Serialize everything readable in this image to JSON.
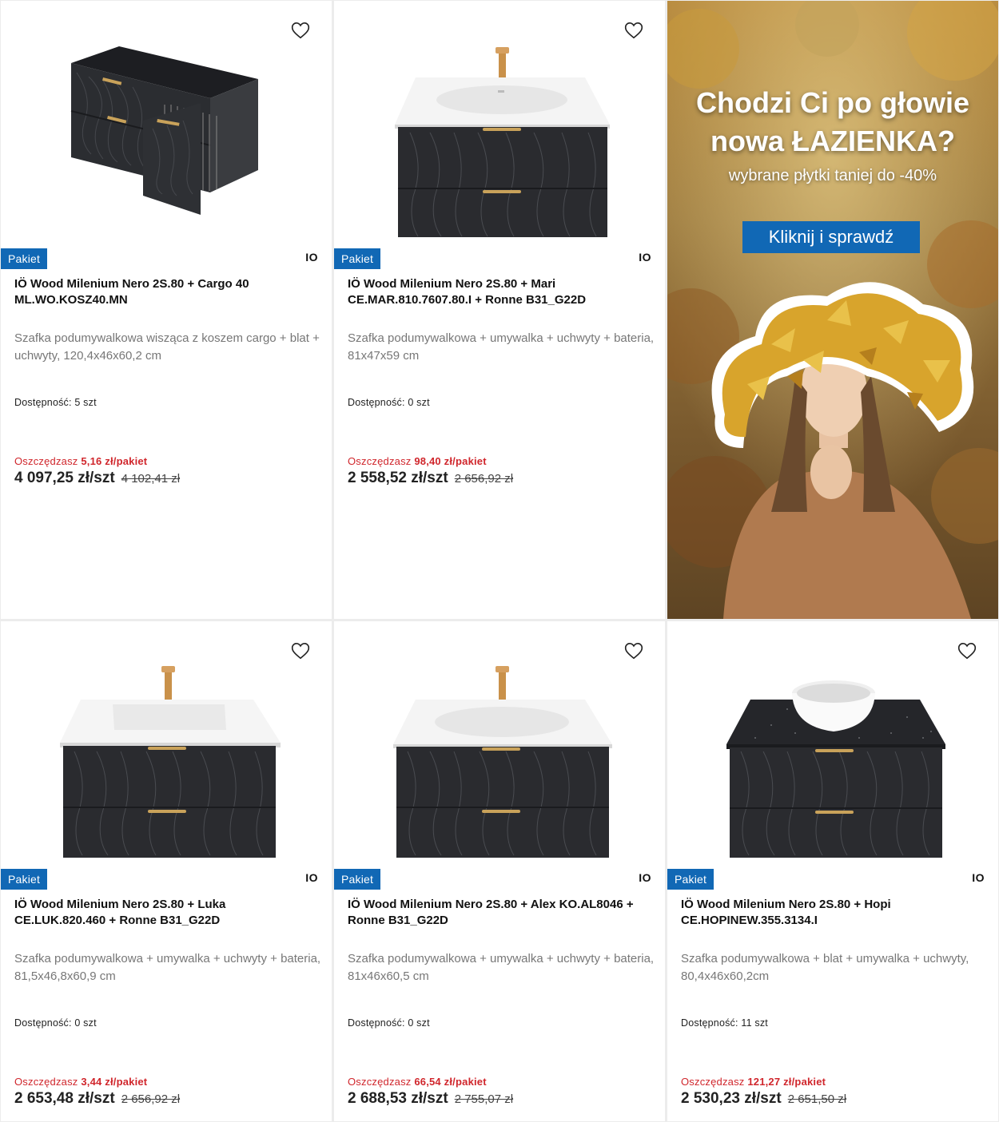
{
  "colors": {
    "accent": "#1168b5",
    "savings": "#d0262c",
    "card_bg": "#ffffff"
  },
  "products": [
    {
      "badge": "Pakiet",
      "brand": "IO",
      "title": "IÖ Wood Milenium Nero 2S.80 + Cargo 40 ML.WO.KOSZ40.MN",
      "description": "Szafka podumywalkowa wisząca z koszem cargo + blat + uchwyty, 120,4x46x60,2 cm",
      "availability": "Dostępność: 5 szt",
      "savings_label": "Oszczędzasz",
      "savings_value": "5,16 zł/pakiet",
      "price": "4 097,25 zł/szt",
      "old_price": "4 102,41 zł",
      "wishlist_icon": "heart-outline-icon"
    },
    {
      "badge": "Pakiet",
      "brand": "IO",
      "title": "IÖ Wood Milenium Nero 2S.80 + Mari CE.MAR.810.7607.80.I + Ronne B31_G22D",
      "description": "Szafka podumywalkowa + umywalka + uchwyty + bateria, 81x47x59 cm",
      "availability": "Dostępność: 0 szt",
      "savings_label": "Oszczędzasz",
      "savings_value": "98,40 zł/pakiet",
      "price": "2 558,52 zł/szt",
      "old_price": "2 656,92 zł",
      "wishlist_icon": "heart-outline-icon"
    },
    {
      "badge": "Pakiet",
      "brand": "IO",
      "title": "IÖ Wood Milenium Nero 2S.80 + Luka CE.LUK.820.460 + Ronne B31_G22D",
      "description": "Szafka podumywalkowa + umywalka + uchwyty + bateria, 81,5x46,8x60,9 cm",
      "availability": "Dostępność: 0 szt",
      "savings_label": "Oszczędzasz",
      "savings_value": "3,44 zł/pakiet",
      "price": "2 653,48 zł/szt",
      "old_price": "2 656,92 zł",
      "wishlist_icon": "heart-outline-icon"
    },
    {
      "badge": "Pakiet",
      "brand": "IO",
      "title": "IÖ Wood Milenium Nero 2S.80 + Alex KO.AL8046 + Ronne B31_G22D",
      "description": "Szafka podumywalkowa + umywalka + uchwyty + bateria, 81x46x60,5 cm",
      "availability": "Dostępność: 0 szt",
      "savings_label": "Oszczędzasz",
      "savings_value": "66,54 zł/pakiet",
      "price": "2 688,53 zł/szt",
      "old_price": "2 755,07 zł",
      "wishlist_icon": "heart-outline-icon"
    },
    {
      "badge": "Pakiet",
      "brand": "IO",
      "title": "IÖ Wood Milenium Nero 2S.80 + Hopi CE.HOPINEW.355.3134.I",
      "description": "Szafka podumywalkowa + blat + umywalka + uchwyty, 80,4x46x60,2cm",
      "availability": "Dostępność: 11 szt",
      "savings_label": "Oszczędzasz",
      "savings_value": "121,27 zł/pakiet",
      "price": "2 530,23 zł/szt",
      "old_price": "2 651,50 zł",
      "wishlist_icon": "heart-outline-icon"
    }
  ],
  "banner": {
    "headline_line1": "Chodzi Ci po głowie",
    "headline_line2": "nowa ŁAZIENKA?",
    "subline": "wybrane płytki taniej do -40%",
    "cta": "Kliknij i sprawdź"
  }
}
